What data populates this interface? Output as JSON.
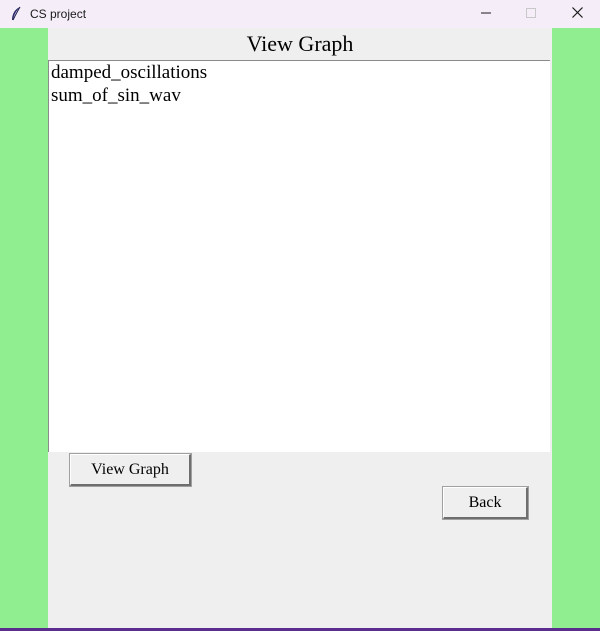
{
  "window": {
    "title": "CS project",
    "icon": "feather-icon",
    "controls": [
      "minimize-icon",
      "maximize-icon",
      "close-icon"
    ]
  },
  "main": {
    "heading": "View Graph",
    "list_items": [
      "damped_oscillations",
      "sum_of_sin_wav"
    ],
    "view_button_label": "View Graph",
    "back_button_label": "Back"
  },
  "colors": {
    "side_background": "#90ee90",
    "panel_background": "#efefef",
    "titlebar_background": "#f5eef8",
    "taskbar_accent": "#5b2d8e"
  }
}
